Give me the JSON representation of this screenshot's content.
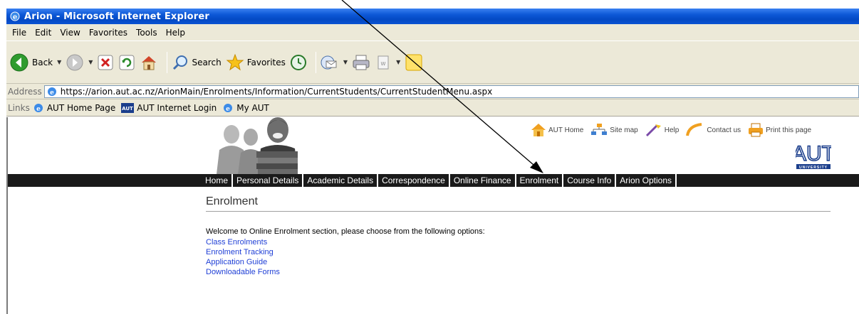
{
  "window": {
    "title": "Arion - Microsoft Internet Explorer"
  },
  "menu": [
    "File",
    "Edit",
    "View",
    "Favorites",
    "Tools",
    "Help"
  ],
  "toolbar": {
    "back_label": "Back",
    "search_label": "Search",
    "favorites_label": "Favorites"
  },
  "address": {
    "label": "Address",
    "url": "https://arion.aut.ac.nz/ArionMain/Enrolments/Information/CurrentStudents/CurrentStudentMenu.aspx"
  },
  "links_bar": {
    "label": "Links",
    "items": [
      "AUT Home Page",
      "AUT Internet Login",
      "My AUT"
    ]
  },
  "site": {
    "top_links": [
      "AUT Home",
      "Site map",
      "Help",
      "Contact us",
      "Print this page"
    ],
    "logo": {
      "text": "AUT",
      "sub": "UNIVERSITY"
    },
    "nav": [
      "Home",
      "Personal Details",
      "Academic Details",
      "Correspondence",
      "Online Finance",
      "Enrolment",
      "Course Info",
      "Arion Options"
    ],
    "page_title": "Enrolment",
    "welcome": "Welcome to Online Enrolment section, please choose from the following options:",
    "options": [
      "Class Enrolments",
      "Enrolment Tracking",
      "Application Guide",
      "Downloadable Forms"
    ]
  },
  "colors": {
    "title_bar": "#0c57d6",
    "chrome": "#ece9d8",
    "navbar": "#1a1a1a",
    "link": "#1f3fd6"
  }
}
